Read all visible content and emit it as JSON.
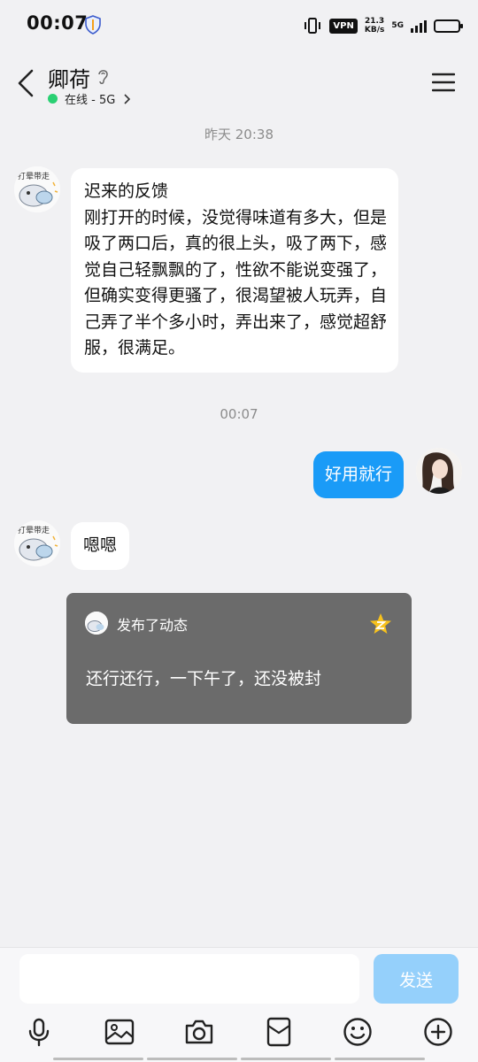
{
  "status_bar": {
    "time": "00:07",
    "vpn": "VPN",
    "speed_value": "21.3",
    "speed_unit": "KB/s",
    "network": "5G"
  },
  "header": {
    "contact_name": "卿荷",
    "status_text": "在线 - 5G",
    "online_color": "#2ad073"
  },
  "messages": {
    "ts_1": "昨天 20:38",
    "msg_1": "迟来的反馈\n刚打开的时候，没觉得味道有多大，但是吸了两口后，真的很上头，吸了两下，感觉自己轻飘飘的了，性欲不能说变强了，但确实变得更骚了，很渴望被人玩弄，自己弄了半个多小时，弄出来了，感觉超舒服，很满足。",
    "ts_2": "00:07",
    "msg_me": "好用就行",
    "msg_2": "嗯嗯"
  },
  "feed_card": {
    "label": "发布了动态",
    "text": "还行还行，一下午了，还没被封"
  },
  "avatar_caption": "打晕带走",
  "input": {
    "placeholder": "",
    "send_label": "发送",
    "send_color": "#95d0fb"
  },
  "toolbar_icons": [
    "mic-icon",
    "image-icon",
    "camera-icon",
    "red-packet-icon",
    "emoji-icon",
    "plus-icon"
  ],
  "colors": {
    "accent": "#1a9bf7",
    "background": "#f1f1f3",
    "card": "#6b6b6b"
  }
}
